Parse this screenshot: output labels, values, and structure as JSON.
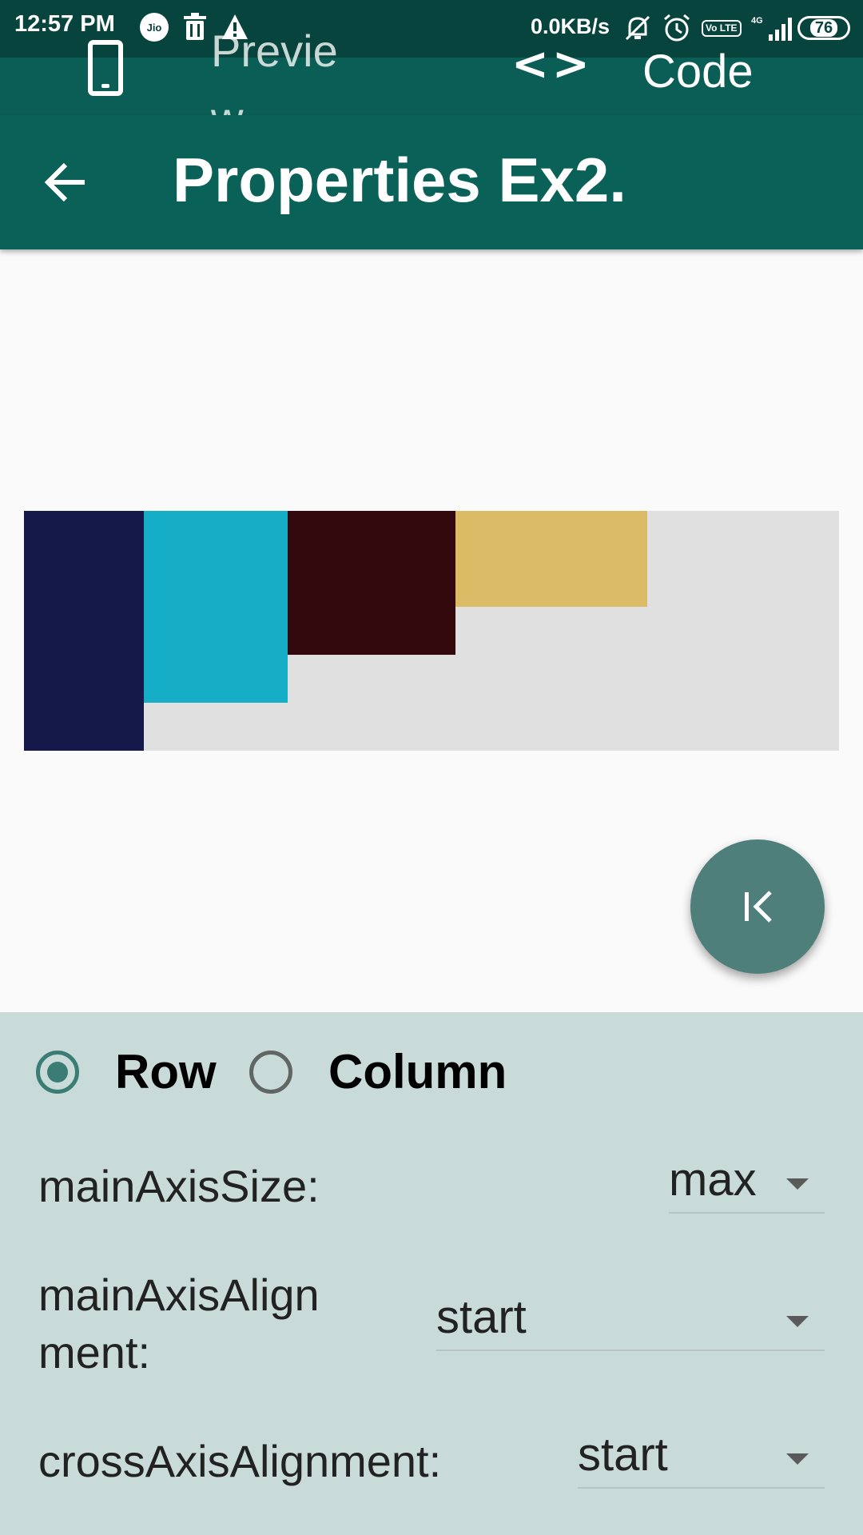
{
  "status_bar": {
    "time": "12:57 PM",
    "carrier_badge": "Jio",
    "net_speed": "0.0KB/s",
    "volte_badge": "Vo LTE",
    "network_label": "4G",
    "battery": "76"
  },
  "tabs": [
    {
      "label": "Preview",
      "icon": "phone-icon"
    },
    {
      "label": "Code",
      "icon": "code-icon"
    }
  ],
  "app_bar": {
    "title": "Properties Ex2."
  },
  "preview": {
    "background": "#e0e0e0",
    "boxes": [
      {
        "color": "#141949"
      },
      {
        "color": "#16adc7"
      },
      {
        "color": "#33090e"
      },
      {
        "color": "#dcbb66"
      }
    ]
  },
  "fab": {
    "icon": "first-page-icon",
    "color": "#4e7f7b"
  },
  "controls": {
    "layout_options": [
      {
        "label": "Row",
        "selected": true
      },
      {
        "label": "Column",
        "selected": false
      }
    ],
    "properties": [
      {
        "label": "mainAxisSize:",
        "value": "max"
      },
      {
        "label": "mainAxisAlign\nment:",
        "value": "start"
      },
      {
        "label": "crossAxisAlignment:",
        "value": "start"
      }
    ]
  }
}
